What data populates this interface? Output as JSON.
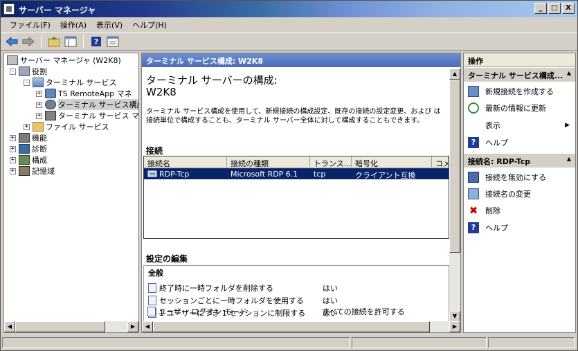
{
  "window": {
    "title": "サーバー マネージャ",
    "buttons": {
      "minimize": "_",
      "maximize": "□",
      "close": "X"
    }
  },
  "menu": [
    "ファイル(F)",
    "操作(A)",
    "表示(V)",
    "ヘルプ(H)"
  ],
  "toolbar": {
    "icons": [
      "back-arrow-icon",
      "forward-arrow-icon",
      "up-folder-icon",
      "show-hide-tree-icon",
      "help-icon",
      "properties-icon"
    ],
    "help_glyph": "?"
  },
  "tree": {
    "root": "サーバー マネージャ (W2K8)",
    "roles": "役割",
    "terminal_services": "ターミナル サービス",
    "ts_remoteapp": "TS RemoteApp マネ",
    "ts_config": "ターミナル サービス構成",
    "ts_manager": "ターミナル サービス マネ",
    "file_services": "ファイル サービス",
    "features": "機能",
    "diagnostics": "診断",
    "configuration": "構成",
    "storage": "記憶域",
    "expand_plus": "+",
    "expand_minus": "-"
  },
  "center": {
    "header": "ターミナル サービス構成: W2K8",
    "title": "ターミナル サーバーの構成:",
    "subtitle": "W2K8",
    "description": "ターミナル サービス構成を使用して、新規接続の構成設定、既存の接続の設定変更、および は接続単位で構成することも、ターミナル サーバー全体に対して構成することもできます。",
    "connections_heading": "接続",
    "columns": [
      "接続名",
      "接続の種類",
      "トランス...",
      "暗号化",
      "コメ"
    ],
    "rows": [
      {
        "name": "RDP-Tcp",
        "type": "Microsoft RDP 6.1",
        "transport": "tcp",
        "encryption": "クライアント互換",
        "comment": ""
      }
    ],
    "settings_heading": "設定の編集",
    "settings_tab": "全般",
    "settings": [
      {
        "label": "終了時に一時フォルダを削除する",
        "value": "はい"
      },
      {
        "label": "セッションごとに一時フォルダを使用する",
        "value": "はい"
      },
      {
        "label": "1 ユーザーにつき 1 セッションに制限する",
        "value": "はい"
      },
      {
        "label": "ユーザー ログオン モード",
        "value": "すべての接続を許可する"
      }
    ]
  },
  "actions": {
    "header": "操作",
    "group1": "ターミナル サービス構成...",
    "group1_items": [
      {
        "label": "新規接続を作成する",
        "icon": "new-connection-icon"
      },
      {
        "label": "最新の情報に更新",
        "icon": "refresh-icon"
      },
      {
        "label": "表示",
        "icon": ""
      },
      {
        "label": "ヘルプ",
        "icon": "help-icon"
      }
    ],
    "group2": "接続名: RDP-Tcp",
    "group2_items": [
      {
        "label": "接続を無効にする",
        "icon": "disable-connection-icon"
      },
      {
        "label": "接続名の変更",
        "icon": "rename-icon"
      },
      {
        "label": "削除",
        "icon": "delete-icon"
      },
      {
        "label": "ヘルプ",
        "icon": "help-icon"
      }
    ],
    "collapse_glyph": "▲",
    "submenu_glyph": "▶",
    "delete_glyph": "✖"
  },
  "scroll": {
    "left": "◀",
    "right": "▶",
    "up": "▲",
    "down": "▼"
  }
}
